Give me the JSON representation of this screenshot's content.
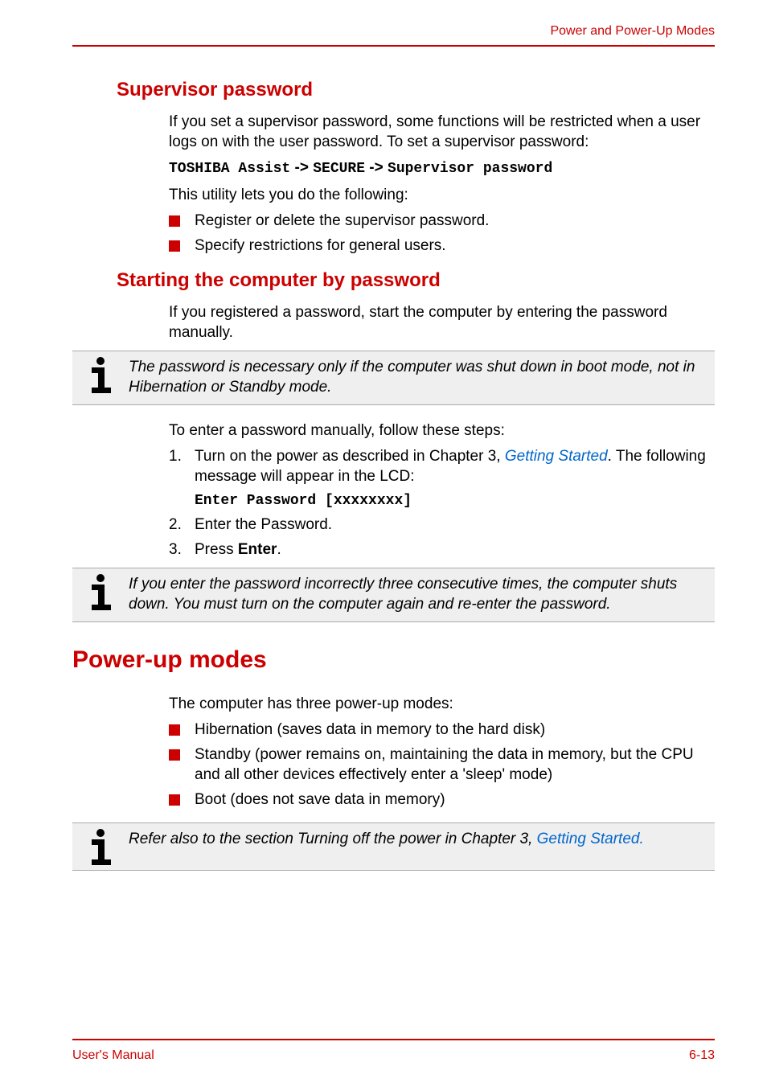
{
  "header": {
    "section_name": "Power and Power-Up Modes"
  },
  "section1": {
    "heading": "Supervisor password",
    "p1": "If you set a supervisor password, some functions will be restricted when a user logs on with the user password. To set a supervisor password:",
    "path_parts": {
      "p1": "TOSHIBA Assist",
      "arrow1": " -> ",
      "p2": "SECURE",
      "arrow2": " -> ",
      "p3": "Supervisor password"
    },
    "p3": "This utility lets you do the following:",
    "bullets": [
      "Register or delete the supervisor password.",
      "Specify restrictions for general users."
    ]
  },
  "section2": {
    "heading": "Starting the computer by password",
    "p1": "If you registered a password, start the computer by entering the password manually.",
    "callout1": "The password is necessary only if the computer was shut down in boot mode, not in Hibernation or Standby mode.",
    "p2": "To enter a password manually, follow these steps:",
    "ol": {
      "i1_pre": "Turn on the power as described in Chapter 3, ",
      "i1_link": "Getting Started",
      "i1_post": ". The following message will appear in the LCD:",
      "i1_mono": "Enter Password [xxxxxxxx]",
      "i2": "Enter the Password.",
      "i3_pre": "Press ",
      "i3_bold": "Enter",
      "i3_post": "."
    },
    "callout2": "If you enter the password incorrectly three consecutive times, the computer shuts down. You must turn on the computer again and re-enter the password."
  },
  "section3": {
    "heading": "Power-up modes",
    "p1": "The computer has three power-up modes:",
    "bullets": [
      "Hibernation (saves data in memory to the hard disk)",
      "Standby (power remains on, maintaining the data in memory, but the CPU and all other devices effectively enter a 'sleep' mode)",
      "Boot (does not save data in memory)"
    ],
    "callout_pre": "Refer also to the section Turning off the power in Chapter 3, ",
    "callout_link": "Getting Started."
  },
  "footer": {
    "left": "User's Manual",
    "right": "6-13"
  }
}
